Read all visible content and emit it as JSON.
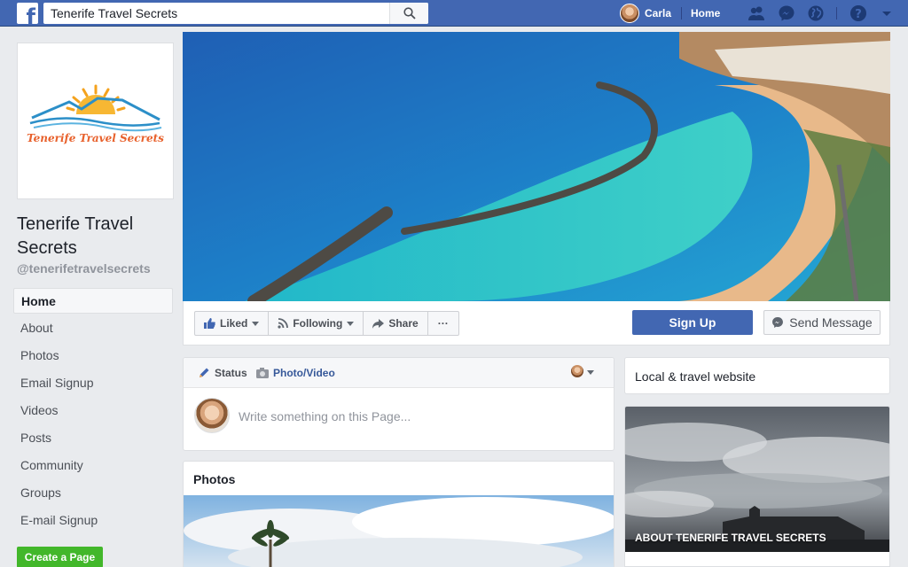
{
  "colors": {
    "brand": "#4267b2",
    "background": "#e9ebee",
    "link": "#365899",
    "create_button": "#42b72a"
  },
  "topbar": {
    "logo_glyph": "f",
    "search_value": "Tenerife Travel Secrets",
    "user_name": "Carla",
    "home_label": "Home",
    "icons": [
      "facebook-logo-icon",
      "search-icon",
      "friend-requests-icon",
      "messenger-icon",
      "notifications-globe-icon",
      "help-icon",
      "account-menu-caret-icon"
    ]
  },
  "sidebar": {
    "logo_text": "Tenerife Travel Secrets",
    "page_name": "Tenerife Travel Secrets",
    "page_handle": "@tenerifetravelsecrets",
    "items": [
      {
        "label": "Home",
        "active": true
      },
      {
        "label": "About"
      },
      {
        "label": "Photos"
      },
      {
        "label": "Email Signup"
      },
      {
        "label": "Videos"
      },
      {
        "label": "Posts"
      },
      {
        "label": "Community"
      },
      {
        "label": "Groups"
      },
      {
        "label": "E-mail Signup"
      }
    ],
    "create_page_label": "Create a Page"
  },
  "actions": {
    "liked_label": "Liked",
    "following_label": "Following",
    "share_label": "Share",
    "more_label": "···",
    "signup_label": "Sign Up",
    "send_message_label": "Send Message"
  },
  "composer": {
    "status_label": "Status",
    "photo_video_label": "Photo/Video",
    "placeholder": "Write something on this Page..."
  },
  "photos": {
    "title": "Photos"
  },
  "right": {
    "category": "Local & travel website",
    "about_label": "ABOUT TENERIFE TRAVEL SECRETS"
  }
}
